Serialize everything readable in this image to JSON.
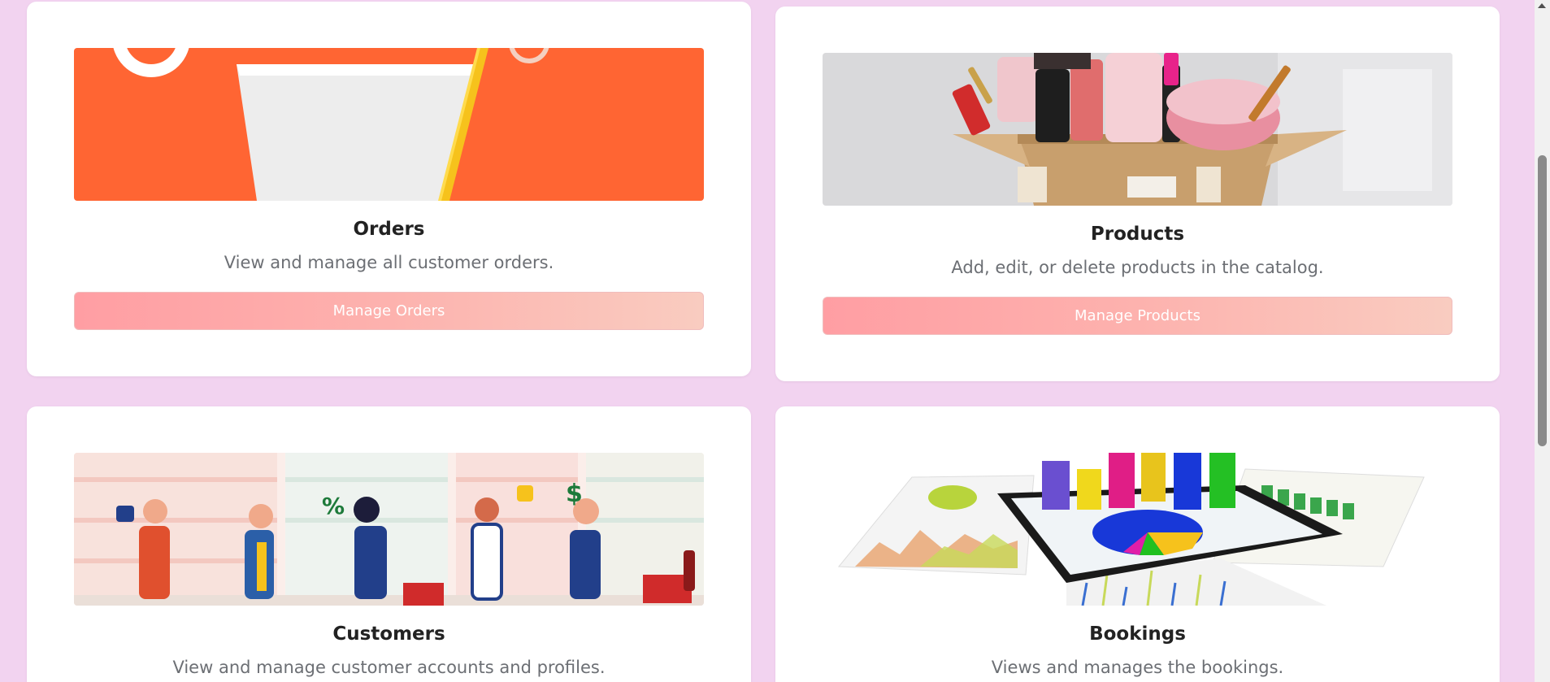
{
  "cards": [
    {
      "title": "Orders",
      "description": "View and manage all customer orders.",
      "button": "Manage Orders",
      "image": "shopping-basket-image"
    },
    {
      "title": "Products",
      "description": "Add, edit, or delete products in the catalog.",
      "button": "Manage Products",
      "image": "cosmetics-box-image"
    },
    {
      "title": "Customers",
      "description": "View and manage customer accounts and profiles.",
      "image": "shoppers-checkout-image",
      "image_text": [
        "%",
        "$"
      ]
    },
    {
      "title": "Bookings",
      "description": "Views and manages the bookings.",
      "image": "charts-tablet-image"
    }
  ],
  "colors": {
    "page_background": "#f2d3f0",
    "card_background": "#ffffff",
    "button_gradient_start": "#ff9ea3",
    "button_gradient_end": "#f9ccc0",
    "title_text": "#222222",
    "description_text": "#6c6f74"
  }
}
